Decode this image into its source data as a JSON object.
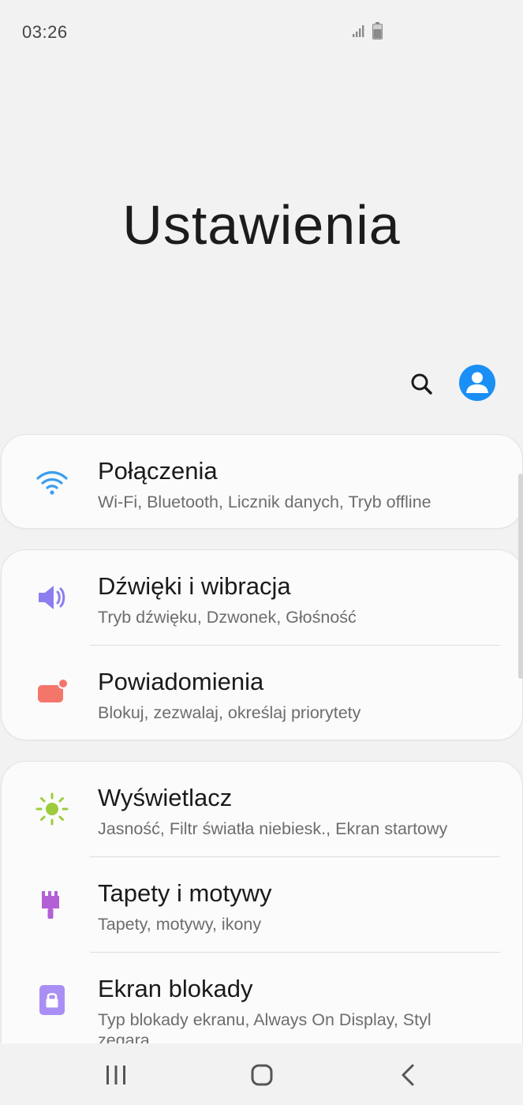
{
  "status_bar": {
    "time": "03:26",
    "icons": [
      "signal-icon",
      "battery-icon"
    ]
  },
  "header": {
    "title": "Ustawienia",
    "actions": [
      "search-icon",
      "account-icon"
    ]
  },
  "colors": {
    "accent": "#1a8ff5",
    "wifi": "#3c9ef0",
    "sound": "#8b7ef0",
    "notifications": "#f4766b",
    "display": "#9ccc3c",
    "wallpaper": "#b35fd6",
    "lock": "#a98ff5"
  },
  "groups": [
    {
      "items": [
        {
          "icon": "wifi-icon",
          "title": "Połączenia",
          "subtitle": "Wi-Fi, Bluetooth, Licznik danych, Tryb offline"
        }
      ]
    },
    {
      "items": [
        {
          "icon": "volume-icon",
          "title": "Dźwięki i wibracja",
          "subtitle": "Tryb dźwięku, Dzwonek, Głośność"
        },
        {
          "icon": "notification-icon",
          "title": "Powiadomienia",
          "subtitle": "Blokuj, zezwalaj, określaj priorytety"
        }
      ]
    },
    {
      "items": [
        {
          "icon": "brightness-icon",
          "title": "Wyświetlacz",
          "subtitle": "Jasność, Filtr światła niebiesk., Ekran startowy"
        },
        {
          "icon": "paintbrush-icon",
          "title": "Tapety i motywy",
          "subtitle": "Tapety, motywy, ikony"
        },
        {
          "icon": "lock-icon",
          "title": "Ekran blokady",
          "subtitle": "Typ blokady ekranu, Always On Display, Styl zegara"
        }
      ]
    }
  ],
  "nav_bar": {
    "buttons": [
      "recents-icon",
      "home-icon",
      "back-icon"
    ]
  }
}
